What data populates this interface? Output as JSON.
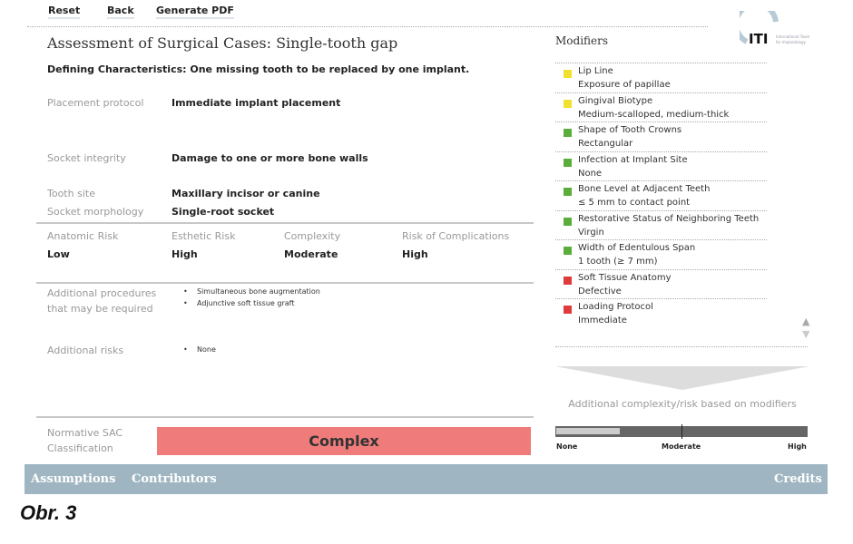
{
  "toolbar": {
    "reset": "Reset",
    "back": "Back",
    "generate_pdf": "Generate PDF"
  },
  "logo": {
    "text": "ITI",
    "subtitle": "International Team for Implantology"
  },
  "title": "Assessment of Surgical Cases: Single-tooth gap",
  "defining": "Defining Characteristics: One missing tooth to be replaced by one implant.",
  "fields": [
    {
      "label": "Placement protocol",
      "value": "Immediate implant placement"
    },
    {
      "label": "Socket integrity",
      "value": "Damage to one or more bone walls"
    },
    {
      "label": "Tooth site",
      "value": "Maxillary incisor or canine"
    },
    {
      "label": "Socket morphology",
      "value": "Single-root socket"
    }
  ],
  "risks": [
    {
      "label": "Anatomic Risk",
      "value": "Low"
    },
    {
      "label": "Esthetic Risk",
      "value": "High"
    },
    {
      "label": "Complexity",
      "value": "Moderate"
    },
    {
      "label": "Risk of Complications",
      "value": "High"
    }
  ],
  "additional_procedures": {
    "label_1": "Additional procedures",
    "label_2": "that may be required",
    "items": [
      "Simultaneous bone augmentation",
      "Adjunctive soft tissue graft"
    ]
  },
  "additional_risks": {
    "label": "Additional risks",
    "items": [
      "None"
    ]
  },
  "classification": {
    "label_1": "Normative SAC",
    "label_2": "Classification",
    "value": "Complex",
    "color": "#ef7b7b"
  },
  "modifiers": {
    "title": "Modifiers",
    "items": [
      {
        "name": "Lip Line",
        "value": "Exposure of papillae",
        "color": "#f0e030"
      },
      {
        "name": "Gingival Biotype",
        "value": "Medium-scalloped, medium-thick",
        "color": "#f0e030"
      },
      {
        "name": "Shape of Tooth Crowns",
        "value": "Rectangular",
        "color": "#5aad3a"
      },
      {
        "name": "Infection at Implant Site",
        "value": "None",
        "color": "#5aad3a"
      },
      {
        "name": "Bone Level at Adjacent Teeth",
        "value": "≤ 5 mm to contact point",
        "color": "#5aad3a"
      },
      {
        "name": "Restorative Status of Neighboring Teeth",
        "value": "Virgin",
        "color": "#5aad3a"
      },
      {
        "name": "Width of Edentulous Span",
        "value": "1 tooth (≥ 7 mm)",
        "color": "#5aad3a"
      },
      {
        "name": "Soft Tissue Anatomy",
        "value": "Defective",
        "color": "#e03a3a"
      },
      {
        "name": "Loading Protocol",
        "value": "Immediate",
        "color": "#e03a3a"
      }
    ]
  },
  "additional_complexity": {
    "title": "Additional complexity/risk based on modifiers",
    "level_percent": 25,
    "labels": [
      "None",
      "Moderate",
      "High"
    ]
  },
  "footer": {
    "assumptions": "Assumptions",
    "contributors": "Contributors",
    "credits": "Credits",
    "color": "#9fb6c2"
  },
  "caption": "Obr. 3"
}
